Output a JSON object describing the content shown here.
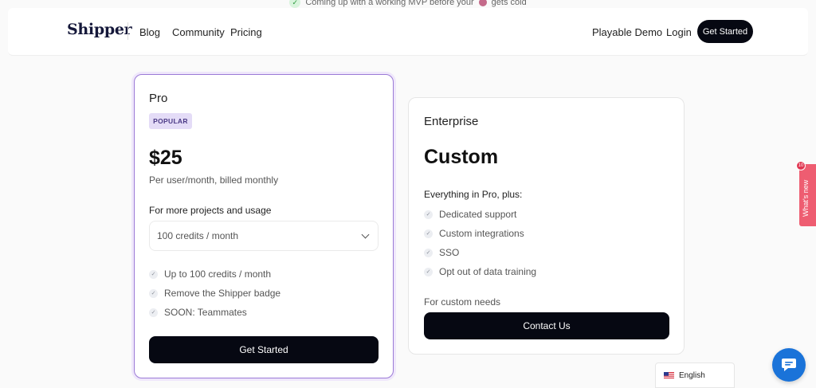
{
  "banner": {
    "text_before": "Coming up with a working MVP before your",
    "text_after": "gets cold"
  },
  "nav": {
    "logo": "Shipper",
    "links": [
      "Blog",
      "Community",
      "Pricing"
    ],
    "right_links": [
      "Playable Demo",
      "Login"
    ],
    "cta": "Get Started"
  },
  "pro": {
    "name": "Pro",
    "badge": "POPULAR",
    "price": "$25",
    "billing": "Per user/month, billed monthly",
    "usage_label": "For more projects and usage",
    "select_value": "100 credits / month",
    "features": [
      "Up to 100 credits / month",
      "Remove the Shipper badge",
      "SOON: Teammates"
    ],
    "cta": "Get Started"
  },
  "enterprise": {
    "name": "Enterprise",
    "price": "Custom",
    "intro": "Everything in Pro, plus:",
    "features": [
      "Dedicated support",
      "Custom integrations",
      "SSO",
      "Opt out of data training"
    ],
    "note": "For custom needs",
    "cta": "Contact Us"
  },
  "whats_new": {
    "label": "What's new",
    "count": "10"
  },
  "language": {
    "value": "English"
  },
  "colors": {
    "accent_border": "#9b7ad6",
    "badge_bg": "#e4dcf7",
    "button_dark": "#060812",
    "whats_new_bg": "#ee5d71",
    "chat_bg": "#1a73d9"
  }
}
